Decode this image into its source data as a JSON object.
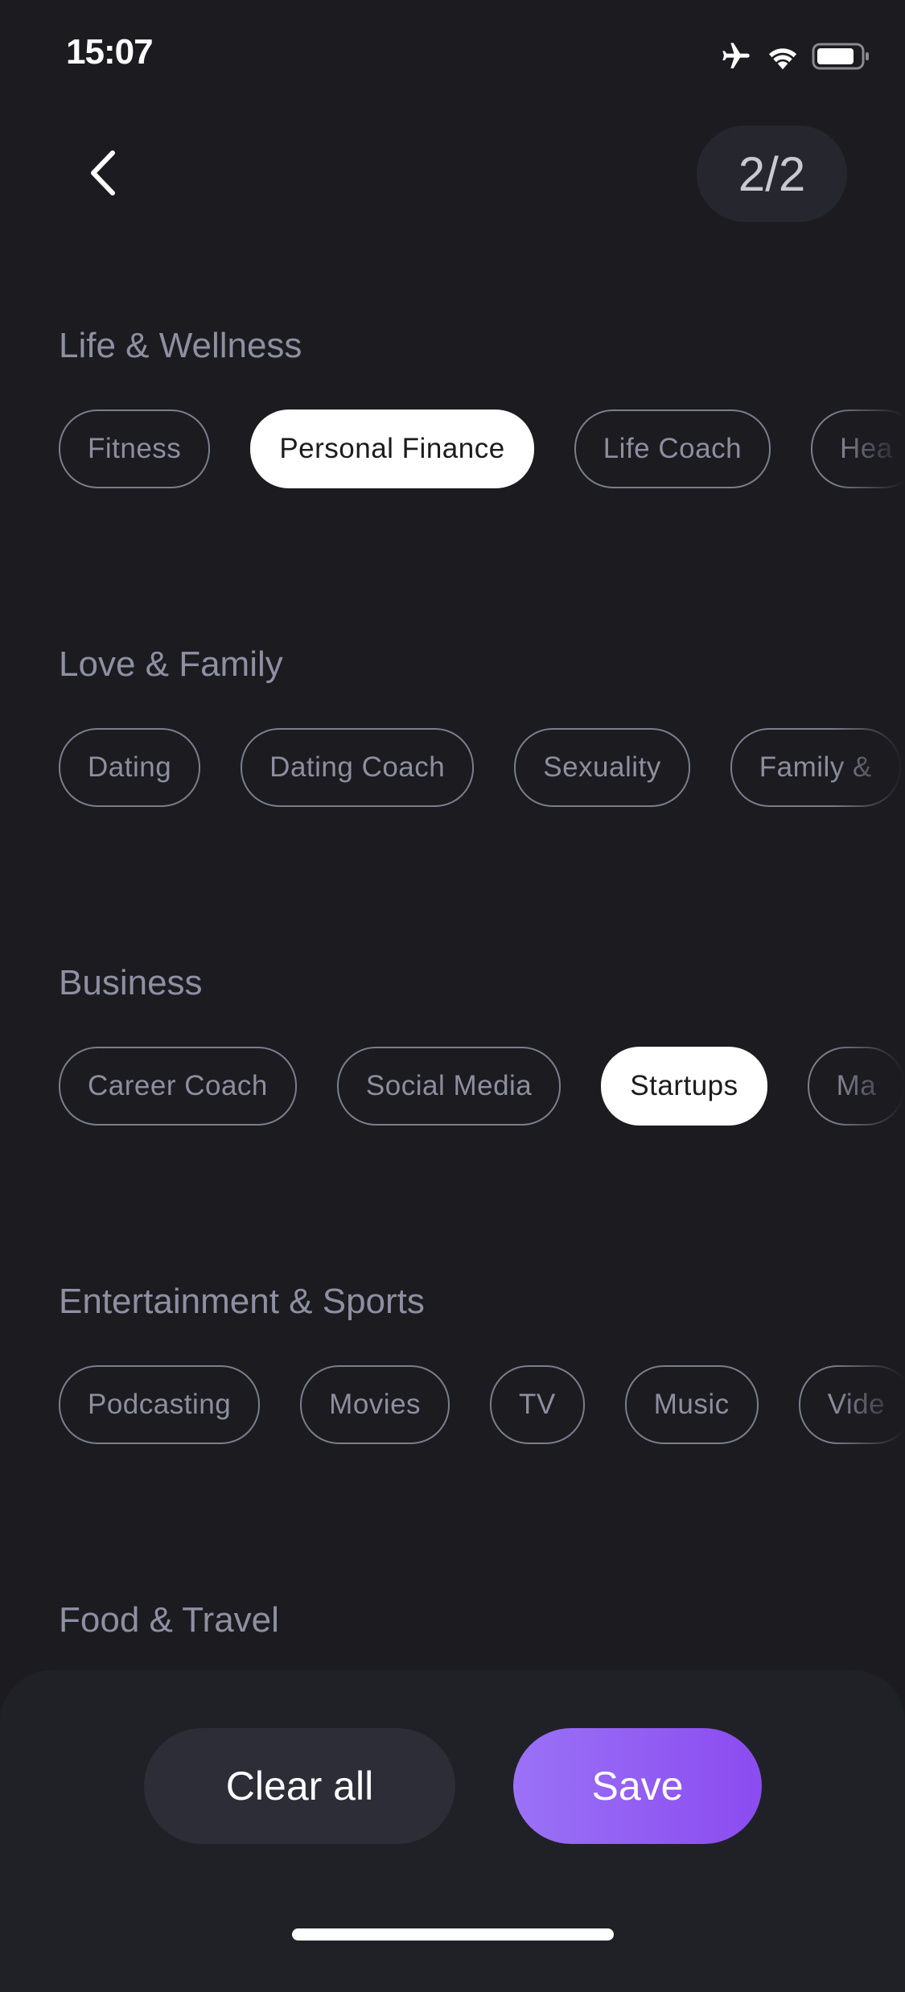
{
  "status_bar": {
    "time": "15:07",
    "icons": [
      "airplane-icon",
      "wifi-icon",
      "battery-icon"
    ]
  },
  "header": {
    "back_icon": "chevron-left-icon",
    "page_counter": "2/2"
  },
  "sections": [
    {
      "title": "Life & Wellness",
      "chips": [
        {
          "label": "Fitness",
          "selected": false
        },
        {
          "label": "Personal Finance",
          "selected": true
        },
        {
          "label": "Life Coach",
          "selected": false
        },
        {
          "label": "Hea",
          "selected": false
        }
      ]
    },
    {
      "title": "Love & Family",
      "chips": [
        {
          "label": "Dating",
          "selected": false
        },
        {
          "label": "Dating Coach",
          "selected": false
        },
        {
          "label": "Sexuality",
          "selected": false
        },
        {
          "label": "Family &",
          "selected": false
        }
      ]
    },
    {
      "title": "Business",
      "chips": [
        {
          "label": "Career Coach",
          "selected": false
        },
        {
          "label": "Social Media",
          "selected": false
        },
        {
          "label": "Startups",
          "selected": true
        },
        {
          "label": "Ma",
          "selected": false
        }
      ]
    },
    {
      "title": "Entertainment & Sports",
      "chips": [
        {
          "label": "Podcasting",
          "selected": false
        },
        {
          "label": "Movies",
          "selected": false
        },
        {
          "label": "TV",
          "selected": false
        },
        {
          "label": "Music",
          "selected": false
        },
        {
          "label": "Vide",
          "selected": false
        }
      ]
    },
    {
      "title": "Food & Travel",
      "chips": []
    }
  ],
  "footer": {
    "clear_label": "Clear all",
    "save_label": "Save"
  },
  "colors": {
    "background": "#1b1b20",
    "accent_start": "#9a72f6",
    "accent_end": "#8b4bf0",
    "chip_border": "#7c7d8c"
  }
}
